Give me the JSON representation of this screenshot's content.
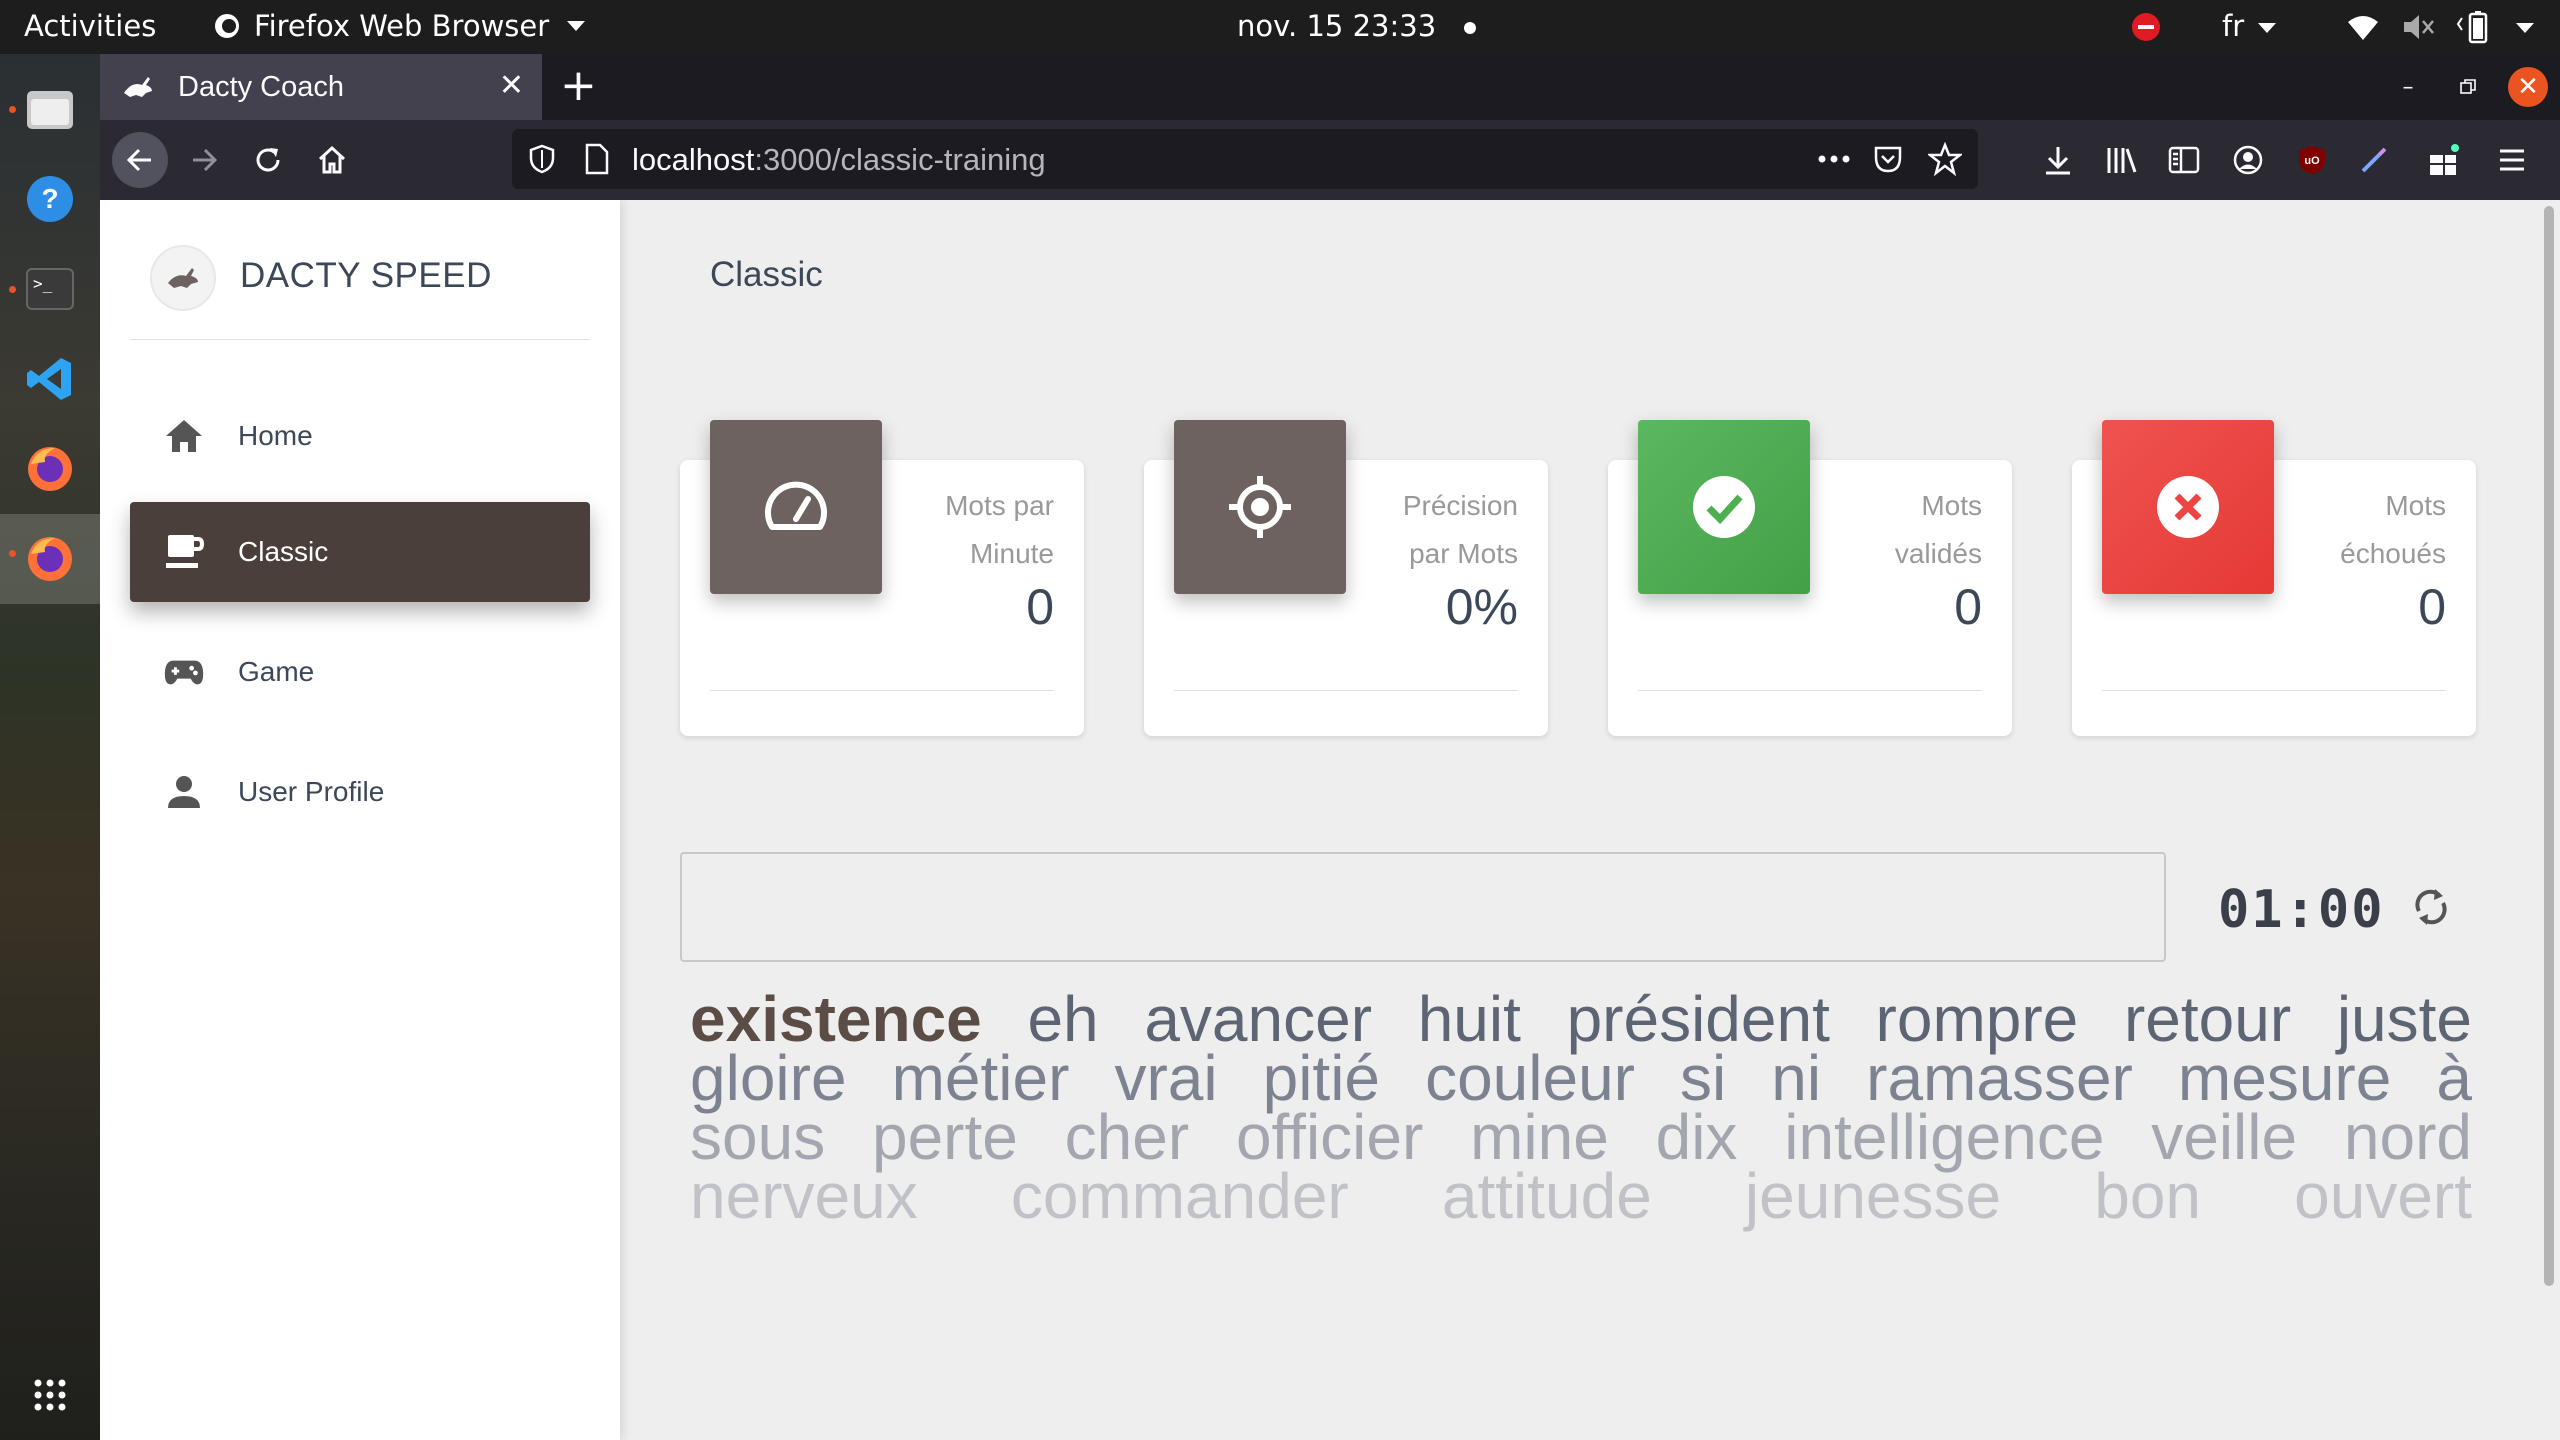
{
  "system": {
    "activities": "Activities",
    "app_menu": "Firefox Web Browser",
    "clock": "nov. 15  23:33",
    "lang": "fr"
  },
  "browser": {
    "tab_title": "Dacty Coach",
    "url_host": "localhost",
    "url_path": ":3000/classic-training"
  },
  "app": {
    "brand": "DACTY SPEED",
    "page_title": "Classic",
    "nav": [
      {
        "label": "Home",
        "icon": "home-icon"
      },
      {
        "label": "Classic",
        "icon": "coffee-icon"
      },
      {
        "label": "Game",
        "icon": "gamepad-icon"
      },
      {
        "label": "User Profile",
        "icon": "person-icon"
      }
    ],
    "stats": [
      {
        "category_line1": "Mots par",
        "category_line2": "Minute",
        "value": "0",
        "color": "#6d625f",
        "icon": "speedometer-icon"
      },
      {
        "category_line1": "Précision",
        "category_line2": "par Mots",
        "value": "0%",
        "color": "#6d625f",
        "icon": "target-icon"
      },
      {
        "category_line1": "Mots",
        "category_line2": "validés",
        "value": "0",
        "color": "#4caf50",
        "icon": "check-circle-icon"
      },
      {
        "category_line1": "Mots",
        "category_line2": "échoués",
        "value": "0",
        "color": "#ef4444",
        "icon": "x-circle-icon"
      }
    ],
    "input_value": "",
    "timer": "01:00",
    "words": [
      [
        "existence",
        "eh",
        "avancer",
        "huit",
        "président",
        "rompre",
        "retour",
        "juste"
      ],
      [
        "gloire",
        "métier",
        "vrai",
        "pitié",
        "couleur",
        "si",
        "ni",
        "ramasser",
        "mesure",
        "à"
      ],
      [
        "sous",
        "perte",
        "cher",
        "officier",
        "mine",
        "dix",
        "intelligence",
        "veille",
        "nord"
      ],
      [
        "nerveux",
        "commander",
        "attitude",
        "jeunesse",
        "bon",
        "ouvert"
      ]
    ]
  }
}
